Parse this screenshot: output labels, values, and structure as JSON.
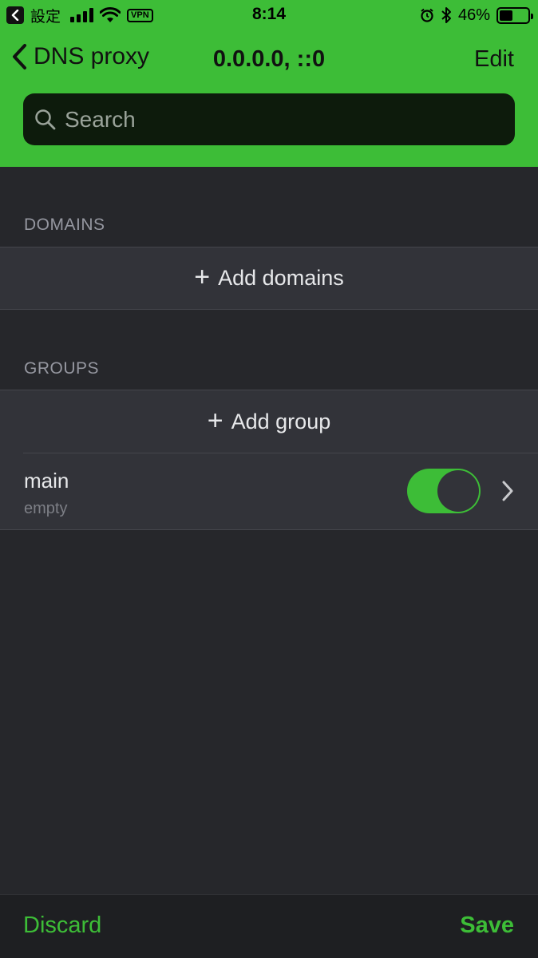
{
  "status_bar": {
    "carrier": "設定",
    "vpn": "VPN",
    "time": "8:14",
    "battery_percent": "46%",
    "battery_level": 0.46
  },
  "nav": {
    "back_label": "DNS proxy",
    "title": "0.0.0.0, ::0",
    "edit_label": "Edit"
  },
  "search": {
    "placeholder": "Search",
    "value": ""
  },
  "domains": {
    "header": "DOMAINS",
    "add_label": "Add domains"
  },
  "groups": {
    "header": "GROUPS",
    "add_label": "Add group",
    "items": [
      {
        "name": "main",
        "subtitle": "empty",
        "enabled": true
      }
    ]
  },
  "toolbar": {
    "discard_label": "Discard",
    "save_label": "Save"
  },
  "colors": {
    "accent": "#3dbd37",
    "background": "#26272b",
    "row": "#323339"
  }
}
